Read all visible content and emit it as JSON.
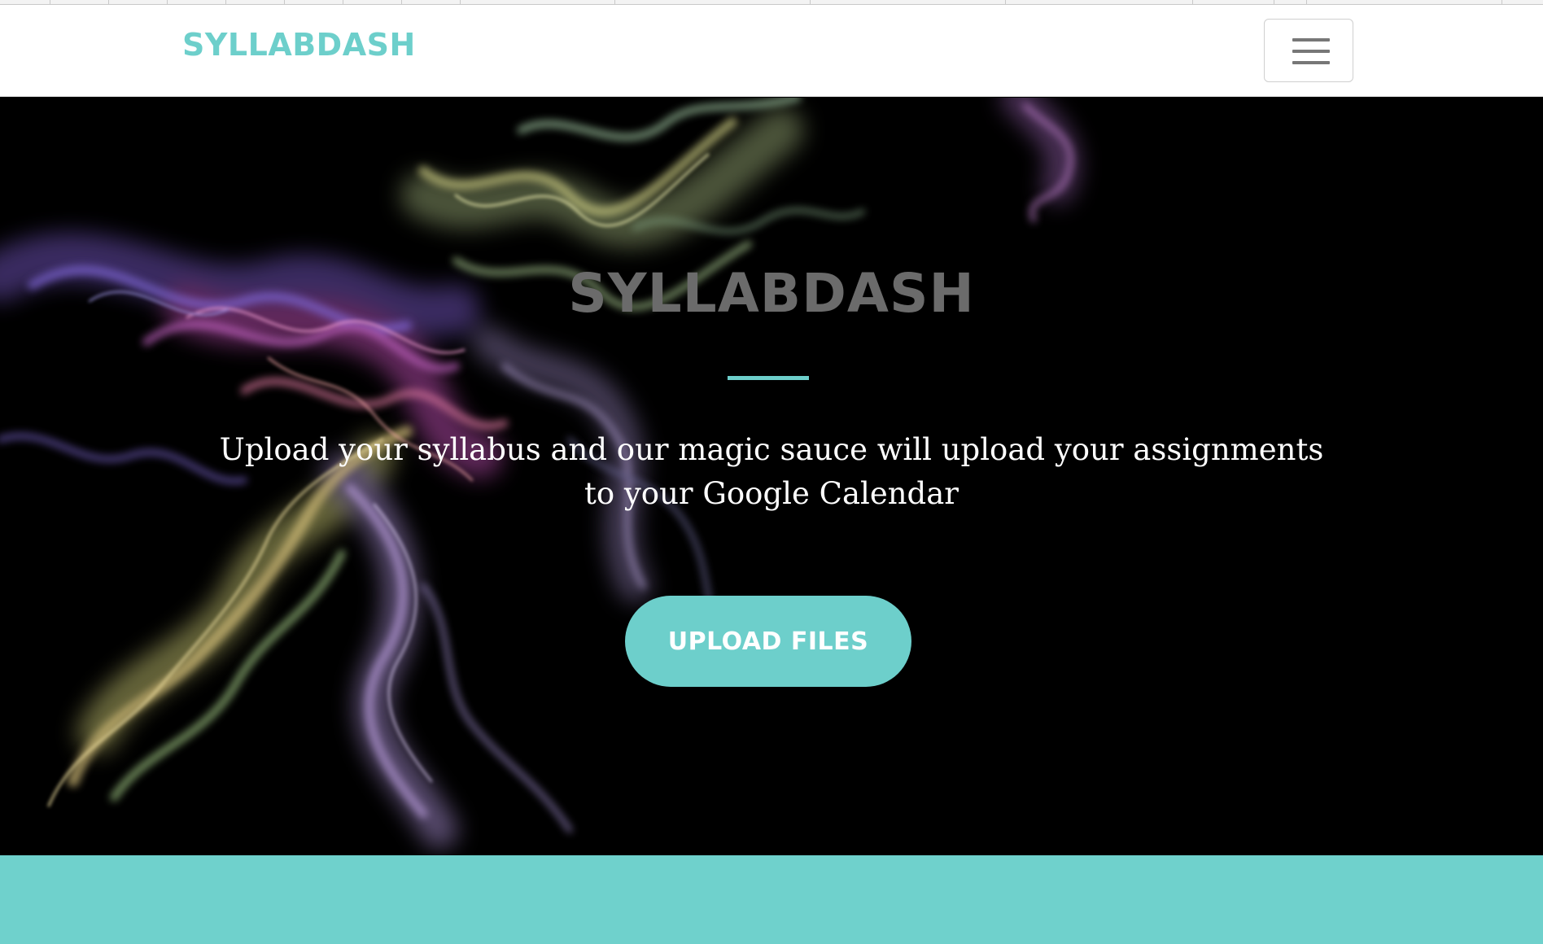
{
  "navbar": {
    "brand": "SYLLABDASH",
    "menu_icon": "hamburger-menu-icon"
  },
  "hero": {
    "title": "SYLLABDASH",
    "subtitle": "Upload your syllabus and our magic sauce will upload your assignments to your Google Calendar",
    "button_label": "UPLOAD FILES",
    "background_image": "colorful-smoke-on-black"
  },
  "colors": {
    "accent": "#6dcfcb",
    "hero_background": "#000000",
    "hero_title": "#6b6b6b",
    "navbar_background": "#ffffff"
  }
}
